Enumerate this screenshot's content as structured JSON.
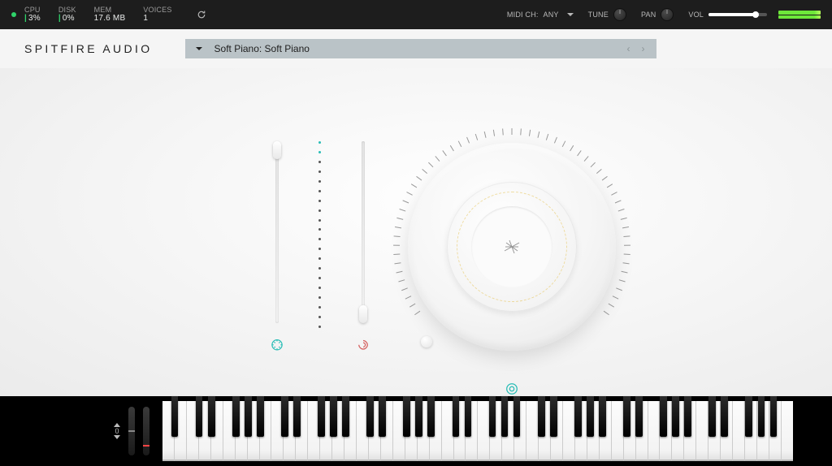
{
  "topbar": {
    "cpu": {
      "label": "CPU",
      "value": "3%"
    },
    "disk": {
      "label": "DISK",
      "value": "0%"
    },
    "mem": {
      "label": "MEM",
      "value": "17.6 MB"
    },
    "voices": {
      "label": "VOICES",
      "value": "1"
    },
    "midi": {
      "label": "MIDI CH:",
      "value": "ANY"
    },
    "tune": {
      "label": "TUNE"
    },
    "pan": {
      "label": "PAN"
    },
    "vol": {
      "label": "VOL"
    }
  },
  "brand": "SPITFIRE AUDIO",
  "preset": {
    "name": "Soft Piano: Soft Piano"
  },
  "sliders": {
    "left": {
      "value_pct": 98,
      "icon": "expression-icon",
      "color": "teal"
    },
    "right": {
      "value_pct": 4,
      "icon": "dynamics-icon",
      "color": "red"
    }
  },
  "dial": {
    "value_pct": 0,
    "icon": "reverb-icon"
  },
  "keyboard": {
    "octave": "0",
    "white_count": 52
  }
}
